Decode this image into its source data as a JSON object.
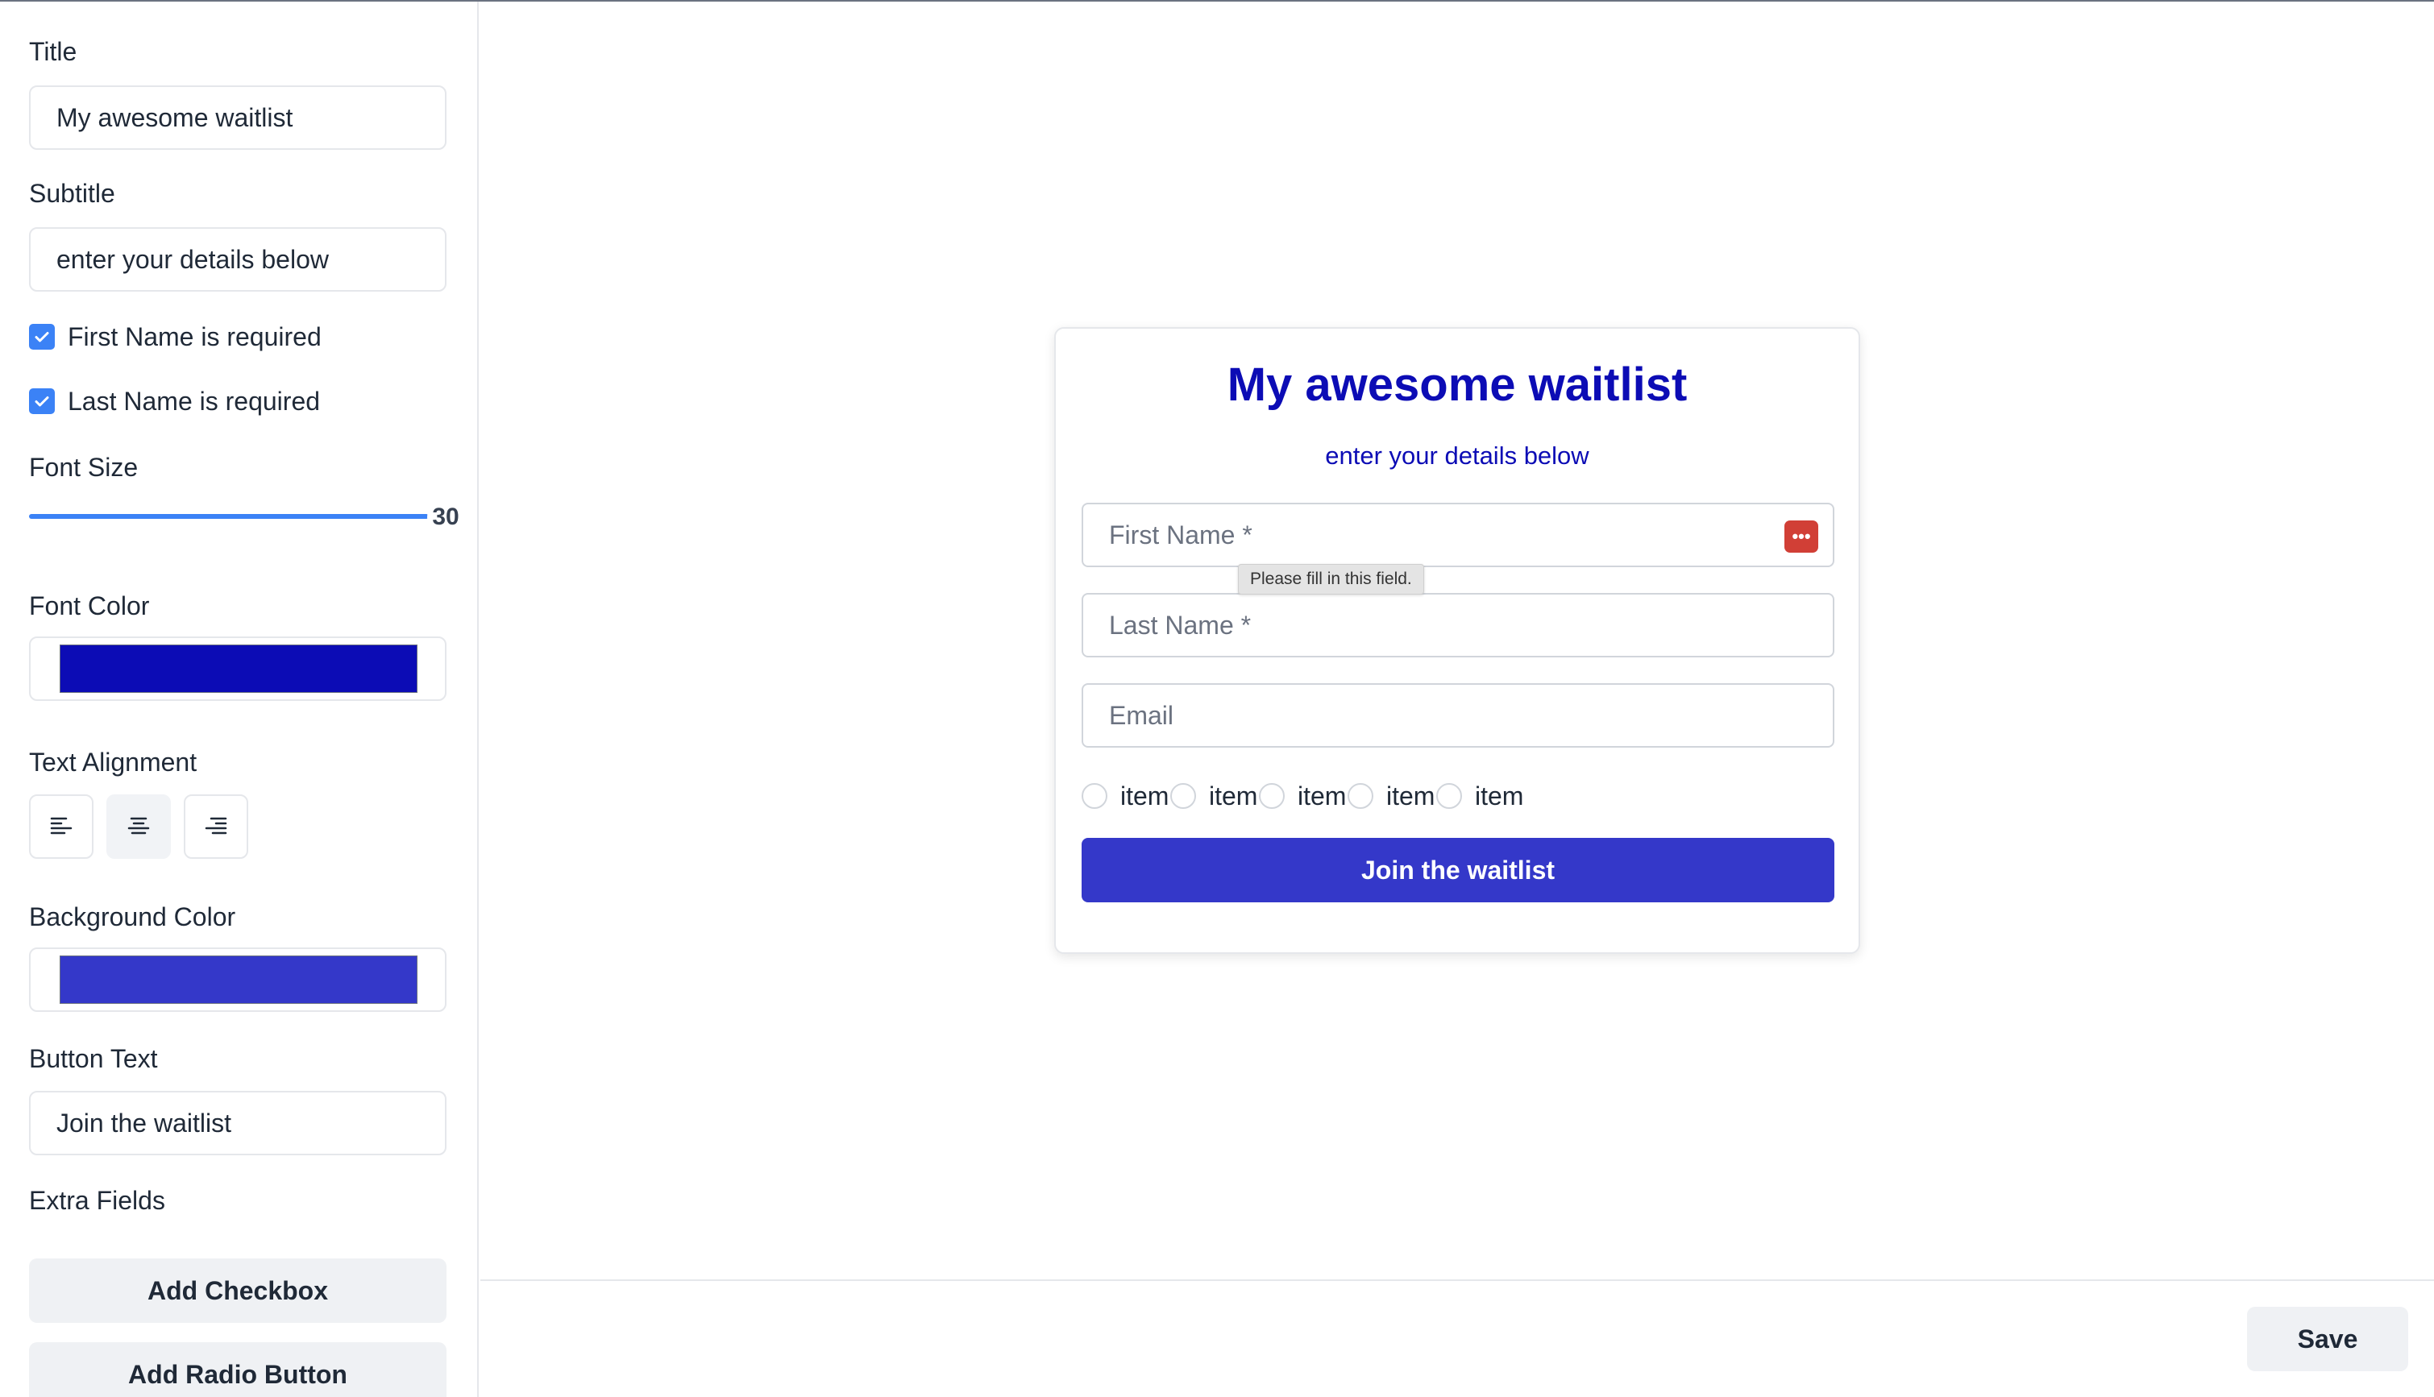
{
  "settings": {
    "title_label": "Title",
    "title_value": "My awesome waitlist",
    "subtitle_label": "Subtitle",
    "subtitle_value": "enter your details below",
    "first_name_required_label": "First Name is required",
    "first_name_required_checked": true,
    "last_name_required_label": "Last Name is required",
    "last_name_required_checked": true,
    "font_size_label": "Font Size",
    "font_size_value": "30",
    "font_color_label": "Font Color",
    "font_color": "#0c0cb5",
    "text_alignment_label": "Text Alignment",
    "text_alignment_options": [
      "left-align-icon",
      "center-align-icon",
      "right-align-icon"
    ],
    "text_alignment_selected": "center",
    "background_color_label": "Background Color",
    "background_color": "#3438c9",
    "button_text_label": "Button Text",
    "button_text_value": "Join the waitlist",
    "extra_fields_label": "Extra Fields",
    "add_checkbox_label": "Add Checkbox",
    "add_radio_label": "Add Radio Button"
  },
  "preview": {
    "title": "My awesome waitlist",
    "subtitle": "enter your details below",
    "first_name_placeholder": "First Name *",
    "last_name_placeholder": "Last Name *",
    "email_placeholder": "Email",
    "tooltip": "Please fill in this field.",
    "password_manager_icon": "password-manager-icon",
    "radio_items": [
      "item",
      "item",
      "item",
      "item",
      "item"
    ],
    "button_label": "Join the waitlist"
  },
  "footer": {
    "save_label": "Save"
  }
}
